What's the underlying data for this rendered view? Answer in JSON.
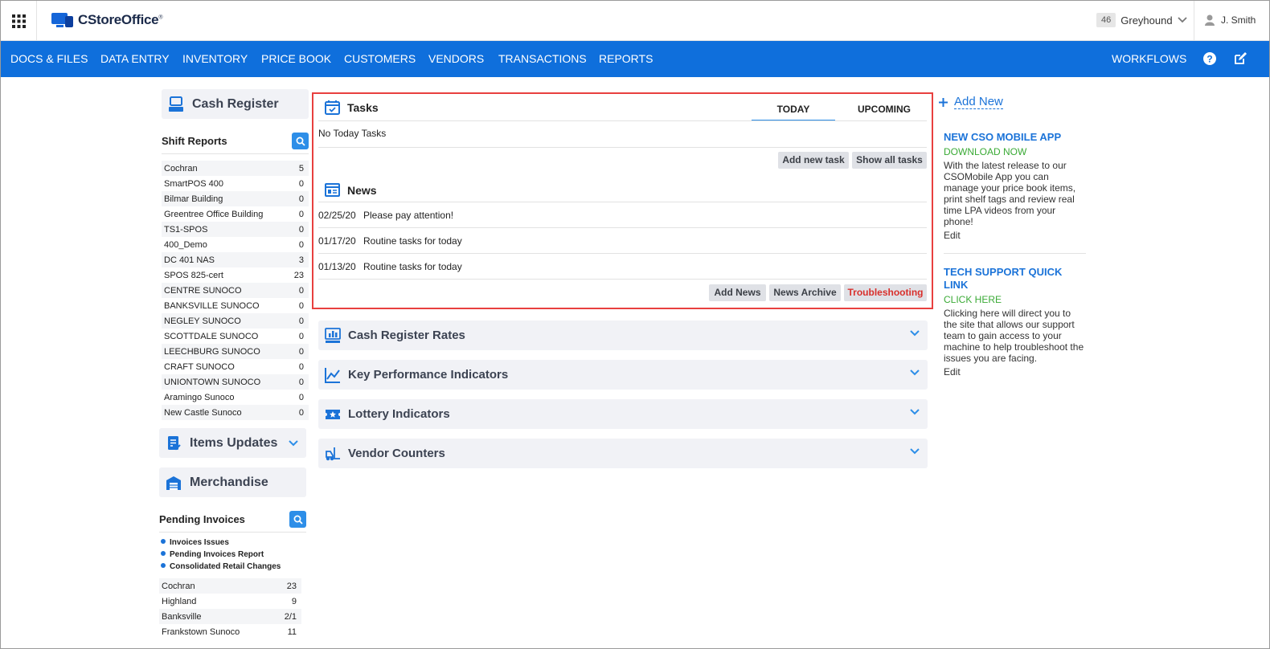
{
  "header": {
    "logo": "CStoreOffice",
    "logo_mark": "®",
    "store_count": "46",
    "store_name": "Greyhound",
    "user_name": "J. Smith"
  },
  "nav": {
    "items": [
      "DOCS & FILES",
      "DATA ENTRY",
      "INVENTORY",
      "PRICE BOOK",
      "CUSTOMERS",
      "VENDORS",
      "TRANSACTIONS",
      "REPORTS"
    ],
    "workflows": "WORKFLOWS"
  },
  "left": {
    "cash_register": "Cash Register",
    "shift_reports": "Shift Reports",
    "shift_rows": [
      {
        "name": "Cochran",
        "count": "5"
      },
      {
        "name": "SmartPOS 400",
        "count": "0"
      },
      {
        "name": "Bilmar Building",
        "count": "0"
      },
      {
        "name": "Greentree Office Building",
        "count": "0"
      },
      {
        "name": "TS1-SPOS",
        "count": "0"
      },
      {
        "name": "400_Demo",
        "count": "0"
      },
      {
        "name": "DC 401 NAS",
        "count": "3"
      },
      {
        "name": "SPOS 825-cert",
        "count": "23"
      },
      {
        "name": "CENTRE SUNOCO",
        "count": "0"
      },
      {
        "name": "BANKSVILLE SUNOCO",
        "count": "0"
      },
      {
        "name": "NEGLEY SUNOCO",
        "count": "0"
      },
      {
        "name": "SCOTTDALE SUNOCO",
        "count": "0"
      },
      {
        "name": "LEECHBURG SUNOCO",
        "count": "0"
      },
      {
        "name": "CRAFT SUNOCO",
        "count": "0"
      },
      {
        "name": "UNIONTOWN SUNOCO",
        "count": "0"
      },
      {
        "name": "Aramingo Sunoco",
        "count": "0"
      },
      {
        "name": "New Castle Sunoco",
        "count": "0"
      }
    ],
    "items_updates": "Items Updates",
    "merchandise": "Merchandise",
    "pending_invoices": "Pending Invoices",
    "invoice_links": [
      "Invoices Issues",
      "Pending Invoices Report",
      "Consolidated Retail Changes"
    ],
    "invoice_rows": [
      {
        "name": "Cochran",
        "count": "23"
      },
      {
        "name": "Highland",
        "count": "9"
      },
      {
        "name": "Banksville",
        "count": "2/1"
      },
      {
        "name": "Frankstown Sunoco",
        "count": "11"
      }
    ]
  },
  "tasks": {
    "title": "Tasks",
    "tab_today": "TODAY",
    "tab_upcoming": "UPCOMING",
    "empty": "No Today Tasks",
    "add_task": "Add new task",
    "show_all": "Show all tasks"
  },
  "news": {
    "title": "News",
    "rows": [
      {
        "date": "02/25/20",
        "text": "Please pay attention!"
      },
      {
        "date": "01/17/20",
        "text": "Routine tasks for today"
      },
      {
        "date": "01/13/20",
        "text": "Routine tasks for today"
      }
    ],
    "add_news": "Add News",
    "archive": "News Archive",
    "troubleshooting": "Troubleshooting"
  },
  "accordions": [
    "Cash Register Rates",
    "Key Performance Indicators",
    "Lottery Indicators",
    "Vendor Counters"
  ],
  "right": {
    "add_new": "Add New",
    "promo1": {
      "title": "NEW CSO MOBILE APP",
      "link": "DOWNLOAD NOW",
      "body": "With the latest release to our CSOMobile App you can manage your price book items, print shelf tags and review real time LPA videos from your phone!",
      "edit": "Edit"
    },
    "promo2": {
      "title": "TECH SUPPORT QUICK LINK",
      "link": "CLICK HERE",
      "body": "Clicking here will direct you to the site that allows our support team to gain access to your machine to help troubleshoot the issues you are facing.",
      "edit": "Edit"
    }
  },
  "colors": {
    "nav_bg": "#0f6fdc",
    "accent": "#2d8ee8",
    "highlight": "#e8403f",
    "troubleshooting": "#d9302c",
    "promo_link": "#3aaa35"
  }
}
